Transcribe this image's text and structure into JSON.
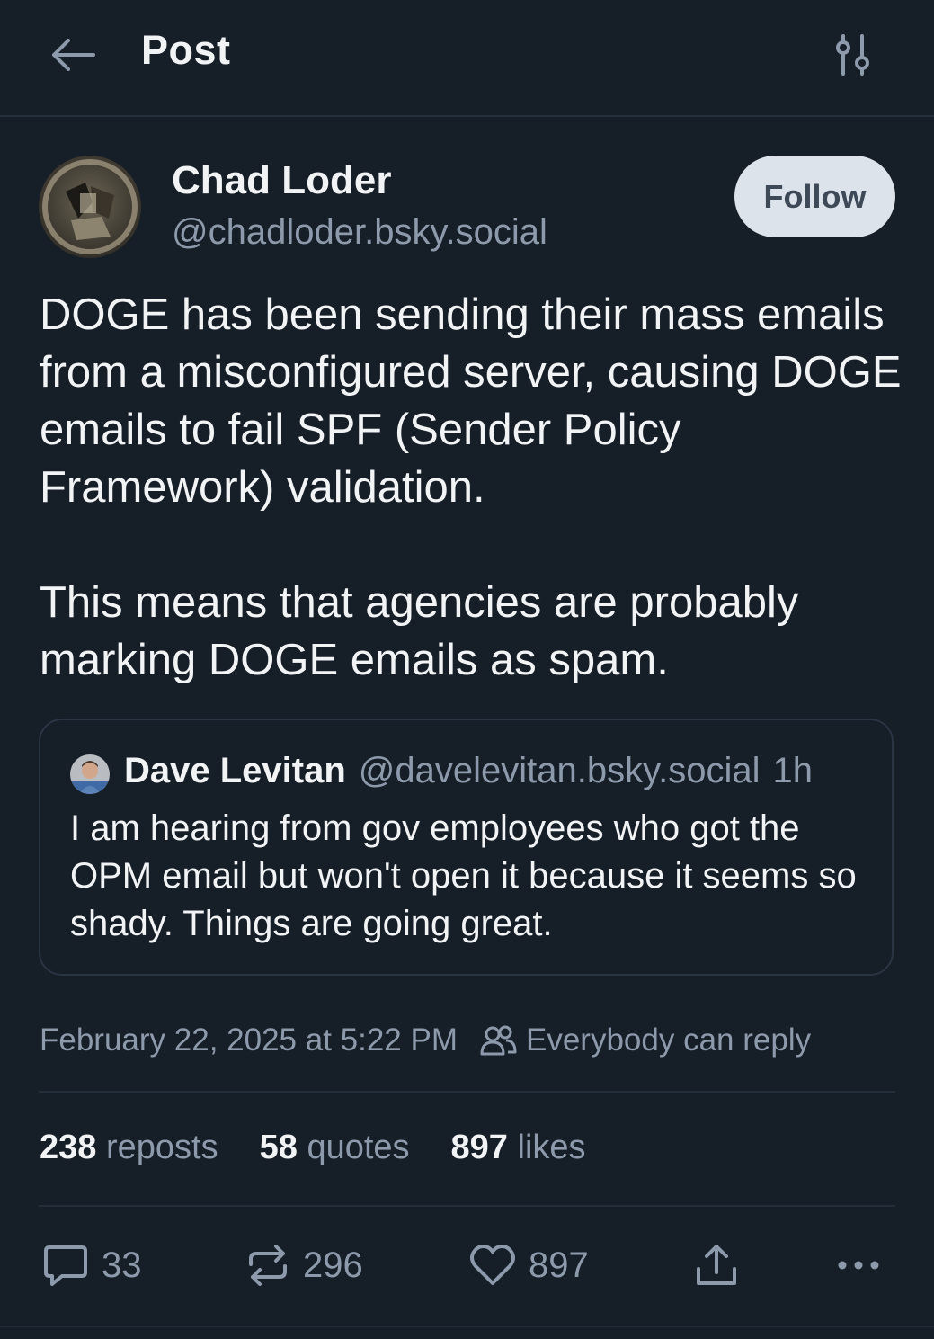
{
  "header": {
    "title": "Post",
    "back_icon": "arrow-left-icon",
    "settings_icon": "sliders-icon"
  },
  "post": {
    "author": {
      "name": "Chad Loder",
      "handle": "@chadloder.bsky.social"
    },
    "follow_label": "Follow",
    "text_paragraphs": [
      "DOGE has been sending their mass emails from a misconfigured server, causing DOGE emails to fail SPF (Sender Policy Framework) validation.",
      "This means that agencies are probably marking DOGE emails as spam."
    ],
    "quote": {
      "name": "Dave Levitan",
      "handle": "@davelevitan.bsky.social",
      "time": "1h",
      "text": "I am hearing from gov employees who got the OPM email but won't open it because it seems so shady. Things are going great."
    },
    "timestamp": "February 22, 2025 at 5:22 PM",
    "reply_setting": "Everybody can reply",
    "stats": [
      {
        "count": "238",
        "label": "reposts"
      },
      {
        "count": "58",
        "label": "quotes"
      },
      {
        "count": "897",
        "label": "likes"
      }
    ],
    "actions": {
      "reply_count": "33",
      "repost_count": "296",
      "like_count": "897"
    }
  },
  "colors": {
    "background": "#161e27",
    "text": "#f1f3f5",
    "muted": "#8d9aab",
    "border": "#232e3b",
    "follow_bg": "#dde3ea"
  }
}
